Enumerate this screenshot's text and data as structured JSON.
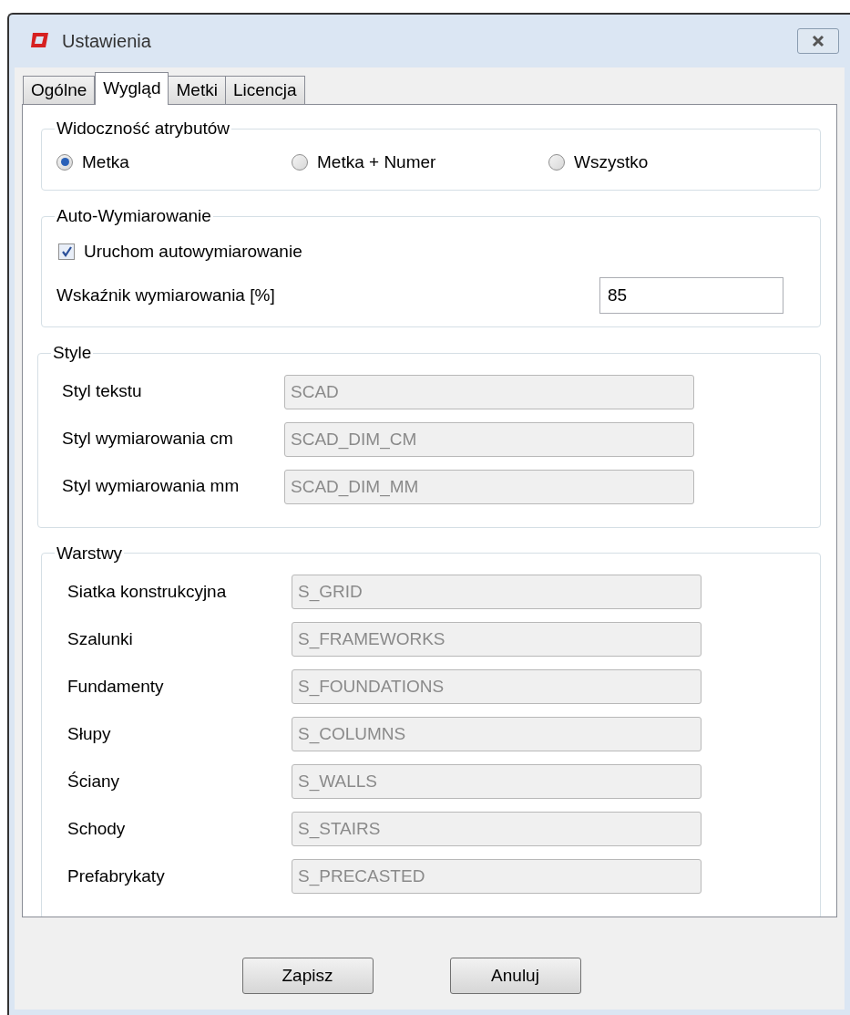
{
  "window": {
    "title": "Ustawienia"
  },
  "tabs": [
    {
      "label": "Ogólne",
      "selected": false
    },
    {
      "label": "Wygląd",
      "selected": true
    },
    {
      "label": "Metki",
      "selected": false
    },
    {
      "label": "Licencja",
      "selected": false
    }
  ],
  "visibility": {
    "title": "Widoczność atrybutów",
    "options": [
      {
        "label": "Metka",
        "selected": true
      },
      {
        "label": "Metka + Numer",
        "selected": false
      },
      {
        "label": "Wszystko",
        "selected": false
      }
    ]
  },
  "auto_dimensioning": {
    "title": "Auto-Wymiarowanie",
    "checkbox": {
      "label": "Uruchom autowymiarowanie",
      "checked": true
    },
    "ratio": {
      "label": "Wskaźnik wymiarowania [%]",
      "value": "85"
    }
  },
  "styles": {
    "title": "Style",
    "fields": [
      {
        "label": "Styl tekstu",
        "value": "SCAD",
        "disabled": true
      },
      {
        "label": "Styl wymiarowania cm",
        "value": "SCAD_DIM_CM",
        "disabled": true
      },
      {
        "label": "Styl wymiarowania mm",
        "value": "SCAD_DIM_MM",
        "disabled": true
      }
    ]
  },
  "layers": {
    "title": "Warstwy",
    "fields": [
      {
        "label": "Siatka konstrukcyjna",
        "value": "S_GRID",
        "disabled": true
      },
      {
        "label": "Szalunki",
        "value": "S_FRAMEWORKS",
        "disabled": true
      },
      {
        "label": "Fundamenty",
        "value": "S_FOUNDATIONS",
        "disabled": true
      },
      {
        "label": "Słupy",
        "value": "S_COLUMNS",
        "disabled": true
      },
      {
        "label": "Ściany",
        "value": "S_WALLS",
        "disabled": true
      },
      {
        "label": "Schody",
        "value": "S_STAIRS",
        "disabled": true
      },
      {
        "label": "Prefabrykaty",
        "value": "S_PRECASTED",
        "disabled": true
      }
    ]
  },
  "buttons": [
    "Zapisz",
    "Anuluj"
  ]
}
